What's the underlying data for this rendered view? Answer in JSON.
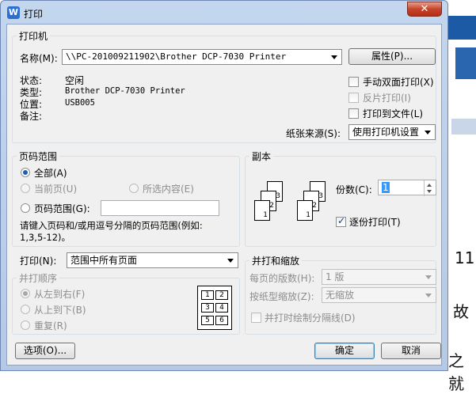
{
  "window": {
    "title": "打印",
    "app_icon": "W",
    "close_glyph": "✕"
  },
  "background": {
    "text_lines": [
      "11",
      "故",
      "之就"
    ]
  },
  "printer": {
    "group_label": "打印机",
    "name_label": "名称(M):",
    "name_value": "\\\\PC-201009211902\\Brother DCP-7030 Printer",
    "properties_button": "属性(P)...",
    "status_label": "状态:",
    "status_value": "空闲",
    "type_label": "类型:",
    "type_value": "Brother DCP-7030 Printer",
    "location_label": "位置:",
    "location_value": "USB005",
    "comment_label": "备注:",
    "duplex_label": "手动双面打印(X)",
    "reverse_label": "反片打印(I)",
    "print_to_file_label": "打印到文件(L)",
    "paper_source_label": "纸张来源(S):",
    "paper_source_value": "使用打印机设置"
  },
  "page_range": {
    "group_label": "页码范围",
    "all_label": "全部(A)",
    "current_label": "当前页(U)",
    "selection_label": "所选内容(E)",
    "pages_label": "页码范围(G):",
    "pages_value": "",
    "hint": "请键入页码和/或用逗号分隔的页码范围(例如:",
    "hint_example": "1,3,5-12)。"
  },
  "copies": {
    "group_label": "副本",
    "count_label": "份数(C):",
    "count_value": "1",
    "collate_label": "逐份打印(T)",
    "page_numbers": [
      "1",
      "2",
      "3"
    ]
  },
  "print_what": {
    "label": "打印(N):",
    "value": "范围中所有页面"
  },
  "order": {
    "group_label": "并打顺序",
    "left_to_right": "从左到右(F)",
    "top_to_bottom": "从上到下(B)",
    "repeat": "重复(R)",
    "grid_numbers": [
      "1",
      "2",
      "3",
      "4",
      "5",
      "6"
    ]
  },
  "zoom": {
    "group_label": "并打和缩放",
    "pages_per_sheet_label": "每页的版数(H):",
    "pages_per_sheet_value": "1 版",
    "scale_label": "按纸型缩放(Z):",
    "scale_value": "无缩放",
    "separator_label": "并打时绘制分隔线(D)"
  },
  "buttons": {
    "options": "选项(O)...",
    "ok": "确定",
    "cancel": "取消"
  }
}
